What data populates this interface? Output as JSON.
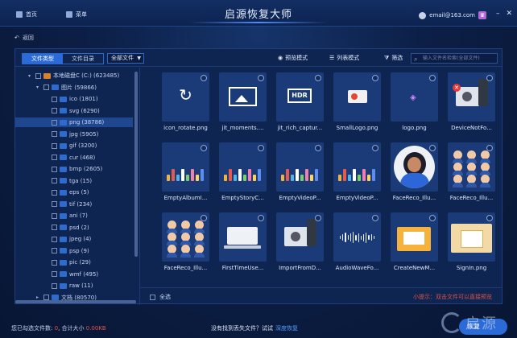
{
  "app": {
    "title": "启源恢复大师"
  },
  "menu": {
    "home": "首页",
    "menu": "菜单"
  },
  "user": {
    "email": "email@163.com",
    "badge": "♛"
  },
  "nav": {
    "back": "返回"
  },
  "toolbar": {
    "tab_file_type": "文件类型",
    "tab_file_dir": "文件目录",
    "filter_select": "全部文件",
    "preview_mode": "预览模式",
    "list_mode": "列表模式",
    "filter": "筛选",
    "search_placeholder": "输入文件名检索(全部文件)"
  },
  "tree": [
    {
      "label": "本地磁盘C (C:) (623485)",
      "kind": "drive",
      "level": 0,
      "expanded": true
    },
    {
      "label": "图片 (59866)",
      "kind": "folder",
      "level": 1,
      "expanded": true
    },
    {
      "label": "ico (1801)",
      "kind": "folder",
      "level": 2
    },
    {
      "label": "svg (6290)",
      "kind": "folder",
      "level": 2
    },
    {
      "label": "png (38786)",
      "kind": "folder",
      "level": 2,
      "selected": true
    },
    {
      "label": "jpg (5905)",
      "kind": "folder",
      "level": 2
    },
    {
      "label": "gif (3200)",
      "kind": "folder",
      "level": 2
    },
    {
      "label": "cur (468)",
      "kind": "folder",
      "level": 2
    },
    {
      "label": "bmp (2605)",
      "kind": "folder",
      "level": 2
    },
    {
      "label": "tga (15)",
      "kind": "folder",
      "level": 2
    },
    {
      "label": "eps (5)",
      "kind": "folder",
      "level": 2
    },
    {
      "label": "tif (234)",
      "kind": "folder",
      "level": 2
    },
    {
      "label": "ani (7)",
      "kind": "folder",
      "level": 2
    },
    {
      "label": "psd (2)",
      "kind": "folder",
      "level": 2
    },
    {
      "label": "jpeg (4)",
      "kind": "folder",
      "level": 2
    },
    {
      "label": "psp (9)",
      "kind": "folder",
      "level": 2
    },
    {
      "label": "pic (29)",
      "kind": "folder",
      "level": 2
    },
    {
      "label": "wmf (495)",
      "kind": "folder",
      "level": 2
    },
    {
      "label": "raw (11)",
      "kind": "folder",
      "level": 2
    },
    {
      "label": "文档 (80570)",
      "kind": "folder",
      "level": 1,
      "expanded": false
    }
  ],
  "files": [
    {
      "name": "icon_rotate.png",
      "thumb": "rotate"
    },
    {
      "name": "jit_moments....",
      "thumb": "image"
    },
    {
      "name": "jit_rich_captur...",
      "thumb": "hdr"
    },
    {
      "name": "SmallLogo.png",
      "thumb": "smalllogo"
    },
    {
      "name": "logo.png",
      "thumb": "tag"
    },
    {
      "name": "DeviceNotFo...",
      "thumb": "device-x"
    },
    {
      "name": "EmptyAlbumI...",
      "thumb": "scene"
    },
    {
      "name": "EmptyStoryC...",
      "thumb": "scene"
    },
    {
      "name": "EmptyVideoP...",
      "thumb": "scene"
    },
    {
      "name": "EmptyVideoP...",
      "thumb": "scene"
    },
    {
      "name": "FaceReco_Illu...",
      "thumb": "portrait"
    },
    {
      "name": "FaceReco_Illu...",
      "thumb": "people"
    },
    {
      "name": "FaceReco_Illu...",
      "thumb": "people"
    },
    {
      "name": "FirstTimeUse...",
      "thumb": "laptop"
    },
    {
      "name": "ImportFromD...",
      "thumb": "device"
    },
    {
      "name": "AudioWaveFo...",
      "thumb": "wave"
    },
    {
      "name": "CreateNewM...",
      "thumb": "easel"
    },
    {
      "name": "SignIn.png",
      "thumb": "signin"
    }
  ],
  "footer": {
    "select_all": "全选",
    "tip": "小提示：双击文件可以直接预览"
  },
  "status": {
    "selected_prefix": "您已勾选文件数:",
    "selected_count": "0",
    "size_prefix": ", 合计大小",
    "size_value": "0.00KB",
    "not_found": "没有找到丢失文件？试试",
    "deep_recover": "深度恢复",
    "recover_button": "恢复"
  },
  "watermark": {
    "text": "启源"
  }
}
